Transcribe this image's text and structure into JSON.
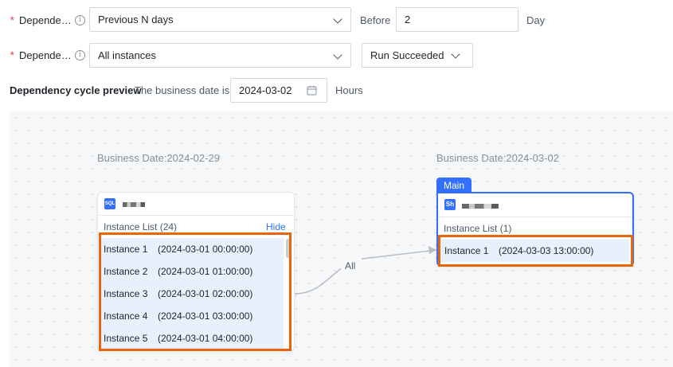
{
  "form": {
    "row1": {
      "label": "Depende…",
      "select": "Previous N days",
      "before_label": "Before",
      "n_value": "2",
      "unit": "Day"
    },
    "row2": {
      "label": "Depende…",
      "select": "All instances",
      "status_select": "Run Succeeded"
    },
    "row3": {
      "title": "Dependency cycle preview",
      "biz_label": "The business date is",
      "date_value": "2024-03-02",
      "unit": "Hours"
    }
  },
  "graph": {
    "edge_label": "All",
    "upstream": {
      "business_date": "Business Date:2024-02-29",
      "type_badge": "SQL",
      "list_title": "Instance List (24)",
      "hide_label": "Hide",
      "instances": [
        {
          "name": "Instance 1",
          "time": "(2024-03-01 00:00:00)"
        },
        {
          "name": "Instance 2",
          "time": "(2024-03-01 01:00:00)"
        },
        {
          "name": "Instance 3",
          "time": "(2024-03-01 02:00:00)"
        },
        {
          "name": "Instance 4",
          "time": "(2024-03-01 03:00:00)"
        },
        {
          "name": "Instance 5",
          "time": "(2024-03-01 04:00:00)"
        }
      ]
    },
    "main": {
      "tag": "Main",
      "business_date": "Business Date:2024-03-02",
      "type_badge": "Sh",
      "list_title": "Instance List (1)",
      "instances": [
        {
          "name": "Instance 1",
          "time": "(2024-03-03 13:00:00)"
        }
      ]
    }
  },
  "colors": {
    "accent": "#3370ff",
    "highlight": "#e8650a",
    "required": "#e5484d",
    "instance_bg": "#e8f0fd"
  }
}
